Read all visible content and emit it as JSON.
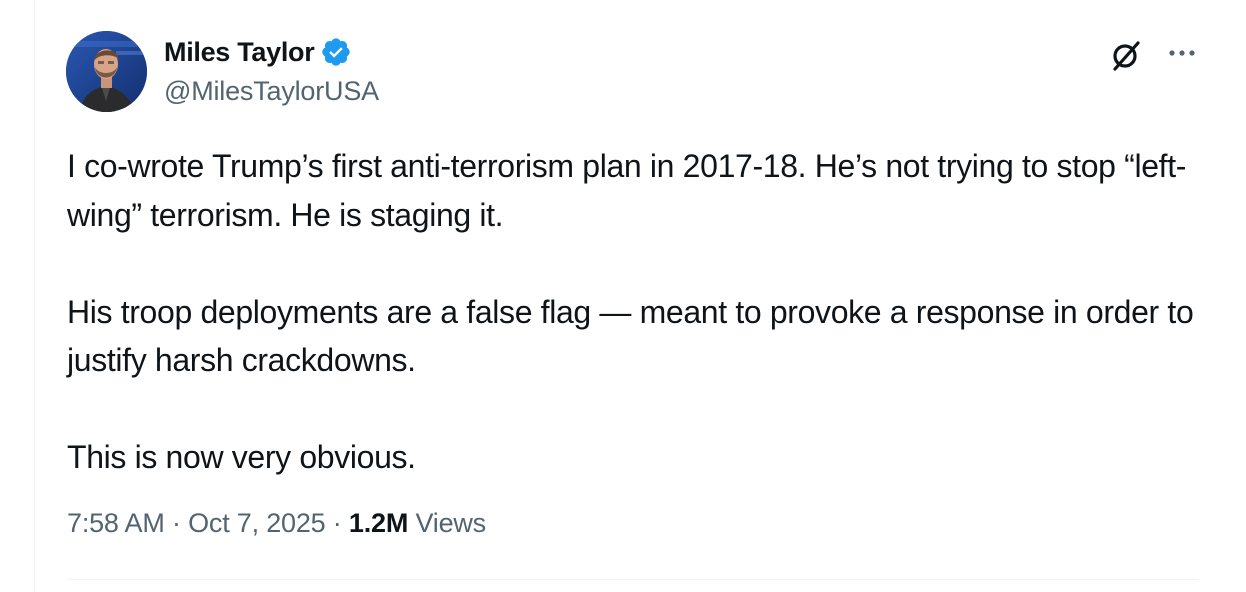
{
  "author": {
    "display_name": "Miles Taylor",
    "handle": "@MilesTaylorUSA",
    "verified": true,
    "verified_badge_color": "#1d9bf0"
  },
  "tweet": {
    "paragraphs": [
      "I co-wrote Trump’s first anti-terrorism plan in 2017-18. He’s not trying to stop “left-wing” terrorism. He is staging it.",
      "His troop deployments are a false flag — meant to provoke a response in order to justify harsh crackdowns.",
      "This is now very obvious."
    ]
  },
  "meta": {
    "time": "7:58 AM",
    "separator": "·",
    "date": "Oct 7, 2025",
    "views_count": "1.2M",
    "views_label": "Views"
  },
  "icons": {
    "top_right": [
      "grok-icon",
      "more-icon"
    ],
    "secondary_text_color": "#536471"
  }
}
